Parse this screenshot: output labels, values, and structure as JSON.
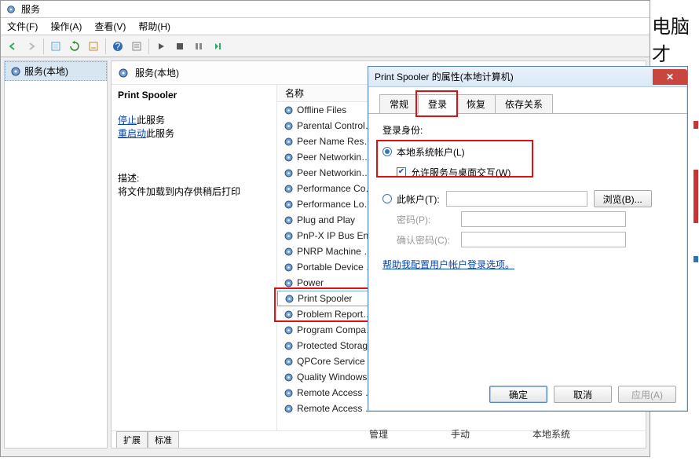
{
  "window": {
    "title": "服务",
    "side_text": "电脑才"
  },
  "menu": {
    "file": "文件(F)",
    "action": "操作(A)",
    "view": "查看(V)",
    "help": "帮助(H)"
  },
  "left_pane": {
    "root": "服务(本地)"
  },
  "detail": {
    "heading": "服务(本地)",
    "service_name": "Print Spooler",
    "stop_link": "停止",
    "stop_suffix": "此服务",
    "restart_link": "重启动",
    "restart_suffix": "此服务",
    "desc_label": "描述:",
    "desc_text": "将文件加载到内存供稍后打印"
  },
  "list": {
    "col_name": "名称",
    "items": [
      "Offline Files",
      "Parental Control…",
      "Peer Name Res…",
      "Peer Networkin…",
      "Peer Networkin…",
      "Performance Co…",
      "Performance Lo…",
      "Plug and Play",
      "PnP-X IP Bus En…",
      "PNRP Machine …",
      "Portable Device …",
      "Power",
      "Print Spooler",
      "Problem Report…",
      "Program Compa…",
      "Protected Storag…",
      "QPCore Service …",
      "Quality Windows…",
      "Remote Access …",
      "Remote Access …"
    ],
    "selected_index": 12
  },
  "tabs_bottom": {
    "ext": "扩展",
    "std": "标准"
  },
  "footer": {
    "col_manage": "管理",
    "col_manual": "手动",
    "col_local": "本地系统"
  },
  "dialog": {
    "title": "Print Spooler 的属性(本地计算机)",
    "tabs": {
      "general": "常规",
      "logon": "登录",
      "recovery": "恢复",
      "deps": "依存关系"
    },
    "logon_as_label": "登录身份:",
    "radio_local": "本地系统帐户(L)",
    "chk_desktop": "允许服务与桌面交互(W)",
    "radio_this": "此帐户(T):",
    "browse": "浏览(B)...",
    "pwd": "密码(P):",
    "pwd2": "确认密码(C):",
    "help_link": "帮助我配置用户帐户登录选项。",
    "ok": "确定",
    "cancel": "取消",
    "apply": "应用(A)"
  }
}
